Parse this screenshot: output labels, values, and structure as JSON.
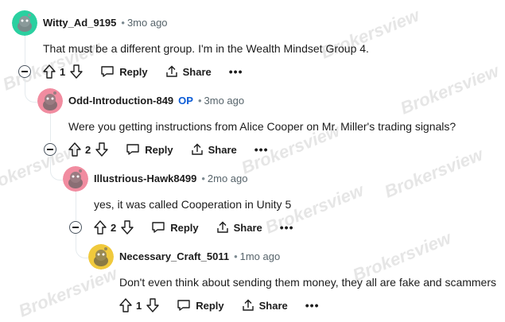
{
  "watermark": "Brokersview",
  "comments": [
    {
      "author": "Witty_Ad_9195",
      "op": "",
      "time": "3mo ago",
      "text": "That must be a different group. I'm in the Wealth Mindset Group 4.",
      "votes": "1",
      "reply": "Reply",
      "share": "Share",
      "more": "•••",
      "avatar_color": "#2ad0a0"
    },
    {
      "author": "Odd-Introduction-849",
      "op": "OP",
      "time": "3mo ago",
      "text": "Were you getting instructions from Alice Cooper on Mr. Miller's trading signals?",
      "votes": "2",
      "reply": "Reply",
      "share": "Share",
      "more": "•••",
      "avatar_color": "#f18ca0"
    },
    {
      "author": "Illustrious-Hawk8499",
      "op": "",
      "time": "2mo ago",
      "text": "yes, it was called Cooperation in Unity 5",
      "votes": "2",
      "reply": "Reply",
      "share": "Share",
      "more": "•••",
      "avatar_color": "#f18ca0"
    },
    {
      "author": "Necessary_Craft_5011",
      "op": "",
      "time": "1mo ago",
      "text": "Don't even think about sending them money, they all are fake and scammers",
      "votes": "1",
      "reply": "Reply",
      "share": "Share",
      "more": "•••",
      "avatar_color": "#f0c93c"
    }
  ]
}
